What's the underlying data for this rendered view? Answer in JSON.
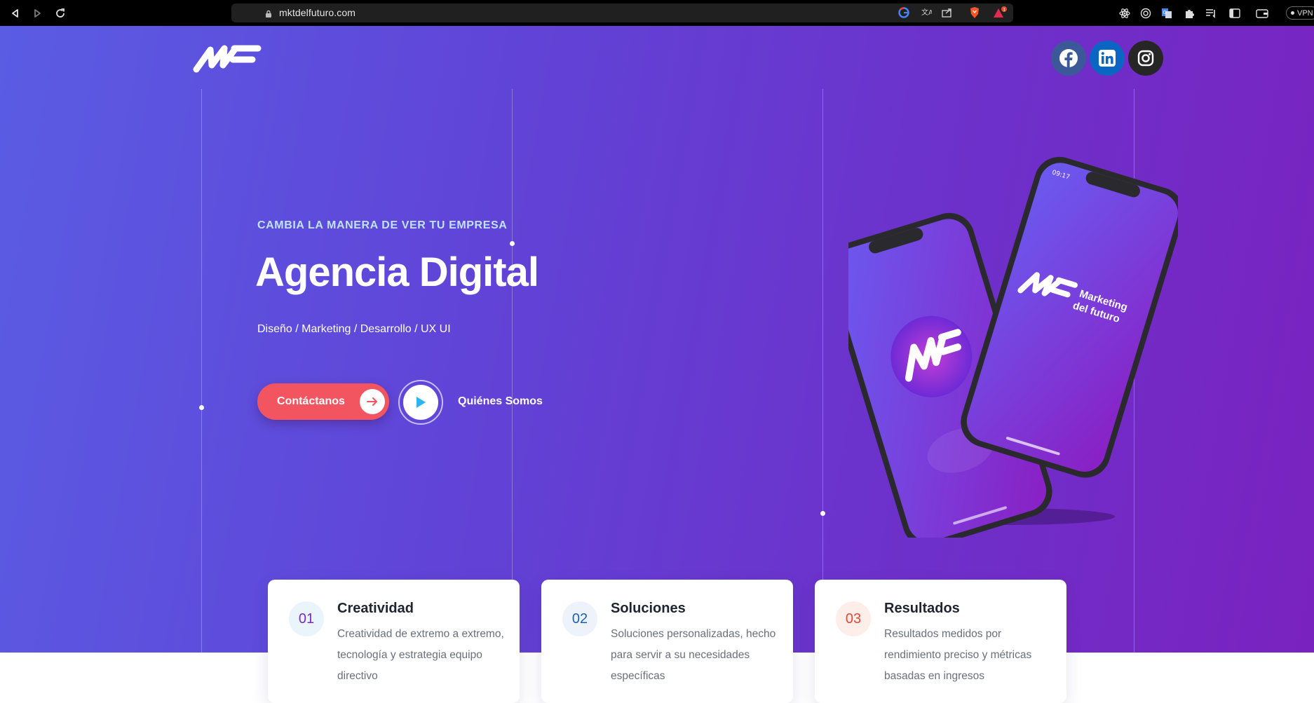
{
  "browser": {
    "url": "mktdelfuturo.com",
    "notification_count": "1",
    "vpn_label": "VPN"
  },
  "site": {
    "logo_text": "MF",
    "social": [
      {
        "name": "Facebook",
        "icon": "facebook-icon",
        "bg": "#3b5998"
      },
      {
        "name": "LinkedIn",
        "icon": "linkedin-icon",
        "bg": "#0a66c2"
      },
      {
        "name": "Instagram",
        "icon": "instagram-icon",
        "bg": "#262626"
      }
    ]
  },
  "hero": {
    "kicker": "CAMBIA LA MANERA DE VER TU EMPRESA",
    "headline": "Agencia Digital",
    "services": "Diseño / Marketing / Desarrollo / UX UI",
    "cta_contact": "Contáctanos",
    "cta_about": "Quiénes Somos",
    "phone_brand_line1": "Marketing",
    "phone_brand_line2": "del futuro",
    "phone_time": "09:17"
  },
  "features": [
    {
      "num": "01",
      "title": "Creatividad",
      "desc": "Creatividad de extremo a extremo, tecnología y estrategia equipo directivo",
      "accent": "#7a2cc9",
      "tint": "#eaf4fb"
    },
    {
      "num": "02",
      "title": "Soluciones",
      "desc": "Soluciones personalizadas, hecho para servir a su necesidades específicas",
      "accent": "#1d5fb8",
      "tint": "#eef3fb"
    },
    {
      "num": "03",
      "title": "Resultados",
      "desc": "Resultados medidos por rendimiento preciso y métricas basadas en ingresos",
      "accent": "#e8472f",
      "tint": "#fdeeea"
    }
  ],
  "colors": {
    "gradient_start": "#5a5ce4",
    "gradient_end": "#7a22c0",
    "cta": "#f2555f",
    "kicker": "#bfe3ff"
  }
}
